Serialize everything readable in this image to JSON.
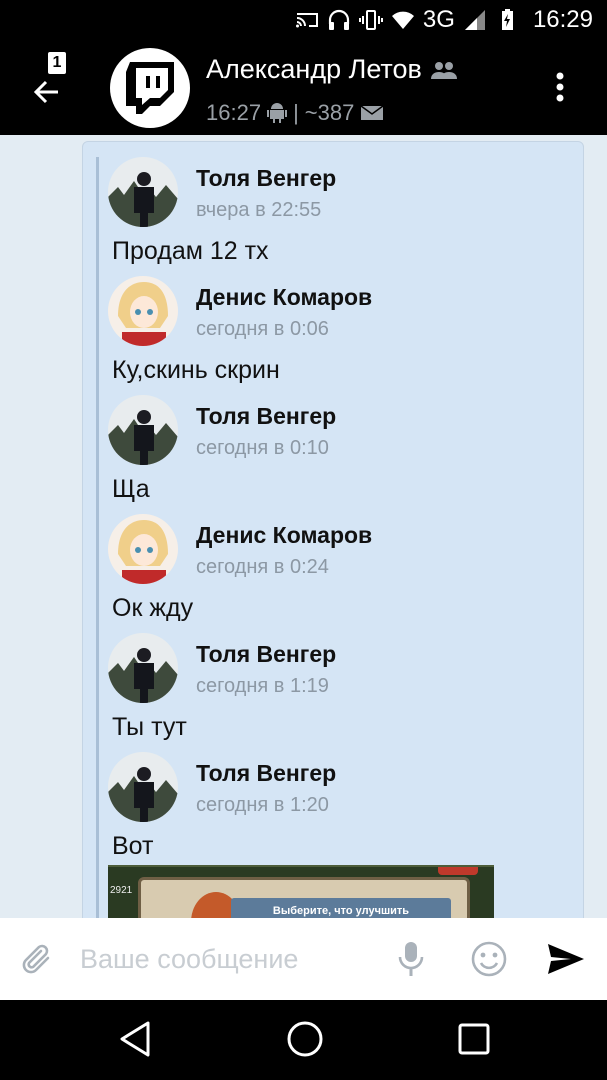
{
  "status_bar": {
    "network": "3G",
    "time": "16:29"
  },
  "header": {
    "notification_count": "1",
    "title": "Александр Летов",
    "subtitle_time": "16:27",
    "subtitle_count": "~387"
  },
  "messages": [
    {
      "author": "Толя Венгер",
      "time": "вчера в 22:55",
      "text": "Продам 12 тх"
    },
    {
      "author": "Денис Комаров",
      "time": "сегодня в 0:06",
      "text": "Ку,скинь скрин"
    },
    {
      "author": "Толя Венгер",
      "time": "сегодня в 0:10",
      "text": "Ща"
    },
    {
      "author": "Денис Комаров",
      "time": "сегодня в 0:24",
      "text": "Ок жду"
    },
    {
      "author": "Толя Венгер",
      "time": "сегодня в 1:19",
      "text": "Ты тут"
    },
    {
      "author": "Толя Венгер",
      "time": "сегодня в 1:20",
      "text": "Вот"
    }
  ],
  "attachment": {
    "banner": "Выберите, что улучшить",
    "side_number": "2921"
  },
  "composer": {
    "placeholder": "Ваше сообщение"
  },
  "colors": {
    "app_bar": "#000000",
    "feed_bg": "#e3ecf3",
    "quote_card": "#d5e5f5",
    "muted_text": "#8c98a4"
  }
}
